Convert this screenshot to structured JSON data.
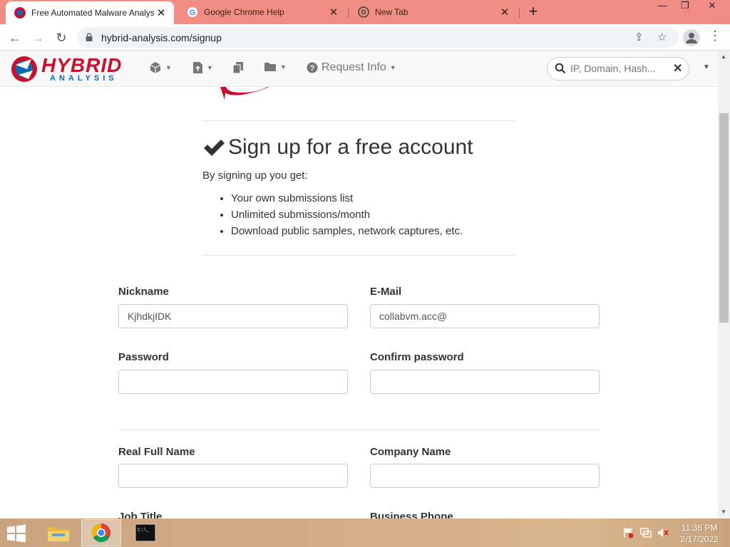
{
  "browser": {
    "tabs": [
      {
        "title": "Free Automated Malware Analysi",
        "active": true
      },
      {
        "title": "Google Chrome Help",
        "active": false
      },
      {
        "title": "New Tab",
        "active": false
      }
    ],
    "new_tab_symbol": "+",
    "url": "hybrid-analysis.com/signup"
  },
  "site_nav": {
    "logo_top": "HYBRID",
    "logo_bottom": "ANALYSIS",
    "request_info_label": "Request Info",
    "search_placeholder": "IP, Domain, Hash..."
  },
  "signup": {
    "heading": "Sign up for a free account",
    "subtext": "By signing up you get:",
    "benefits": [
      "Your own submissions list",
      "Unlimited submissions/month",
      "Download public samples, network captures, etc."
    ]
  },
  "form": {
    "nickname_label": "Nickname",
    "nickname_value": "KjhdkjIDK",
    "email_label": "E-Mail",
    "email_value": "collabvm.acc@",
    "password_label": "Password",
    "confirm_label": "Confirm password",
    "fullname_label": "Real Full Name",
    "company_label": "Company Name",
    "jobtitle_label": "Job Title",
    "phone_label": "Business Phone"
  },
  "taskbar": {
    "time": "11:36 PM",
    "date": "2/17/2022"
  },
  "colors": {
    "tabstrip": "#f08d85",
    "brand_red": "#c8102e",
    "brand_blue": "#0a6ab5",
    "taskbar": "#d2ac86"
  }
}
